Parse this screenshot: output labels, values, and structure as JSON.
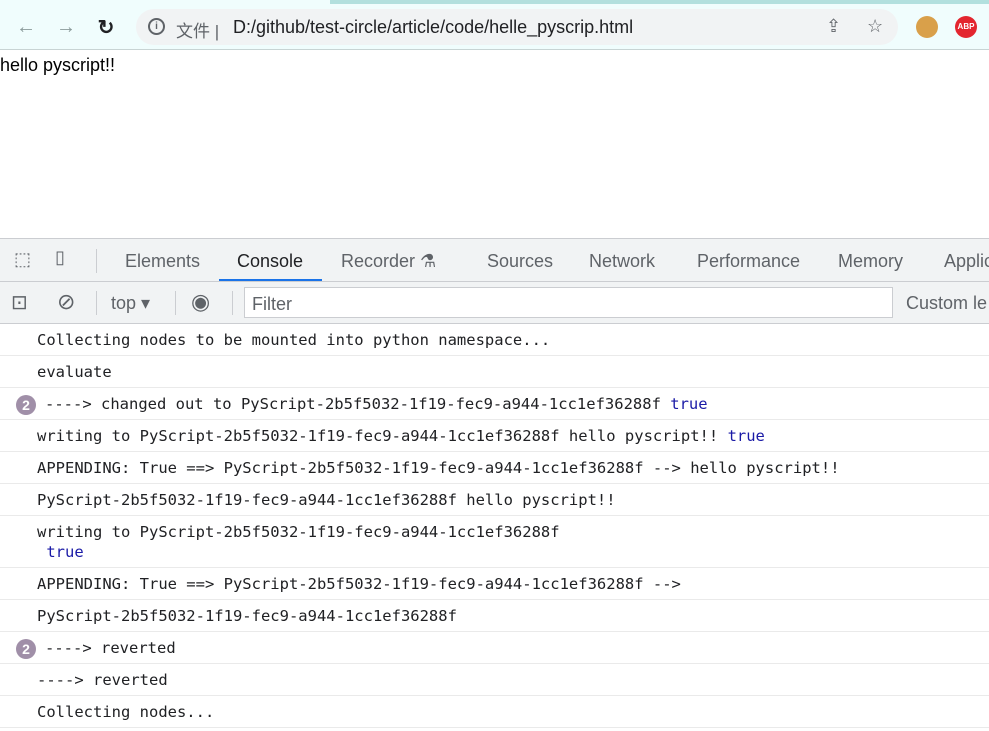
{
  "browser": {
    "scheme_label": "文件",
    "url": "D:/github/test-circle/article/code/helle_pyscrip.html",
    "abp_label": "ABP"
  },
  "page": {
    "text": "hello pyscript!!"
  },
  "devtools": {
    "tabs": [
      "Elements",
      "Console",
      "Recorder",
      "Sources",
      "Network",
      "Performance",
      "Memory",
      "Applic"
    ],
    "active_tab": "Console",
    "context": "top",
    "filter_placeholder": "Filter",
    "custom_levels": "Custom le"
  },
  "console": [
    {
      "text": "Collecting nodes to be mounted into python namespace..."
    },
    {
      "text": "evaluate"
    },
    {
      "count": "2",
      "text": "----> changed out to PyScript-2b5f5032-1f19-fec9-a944-1cc1ef36288f ",
      "kw": "true"
    },
    {
      "text": "writing to PyScript-2b5f5032-1f19-fec9-a944-1cc1ef36288f hello pyscript!! ",
      "kw": "true"
    },
    {
      "text": "APPENDING: True ==> PyScript-2b5f5032-1f19-fec9-a944-1cc1ef36288f --> hello pyscript!!"
    },
    {
      "text": "PyScript-2b5f5032-1f19-fec9-a944-1cc1ef36288f hello pyscript!!"
    },
    {
      "text": "writing to PyScript-2b5f5032-1f19-fec9-a944-1cc1ef36288f\n ",
      "kw": "true"
    },
    {
      "text": "APPENDING: True ==> PyScript-2b5f5032-1f19-fec9-a944-1cc1ef36288f -->"
    },
    {
      "text": "PyScript-2b5f5032-1f19-fec9-a944-1cc1ef36288f"
    },
    {
      "count": "2",
      "text": "----> reverted"
    },
    {
      "text": "----> reverted"
    },
    {
      "text": "Collecting nodes..."
    }
  ]
}
